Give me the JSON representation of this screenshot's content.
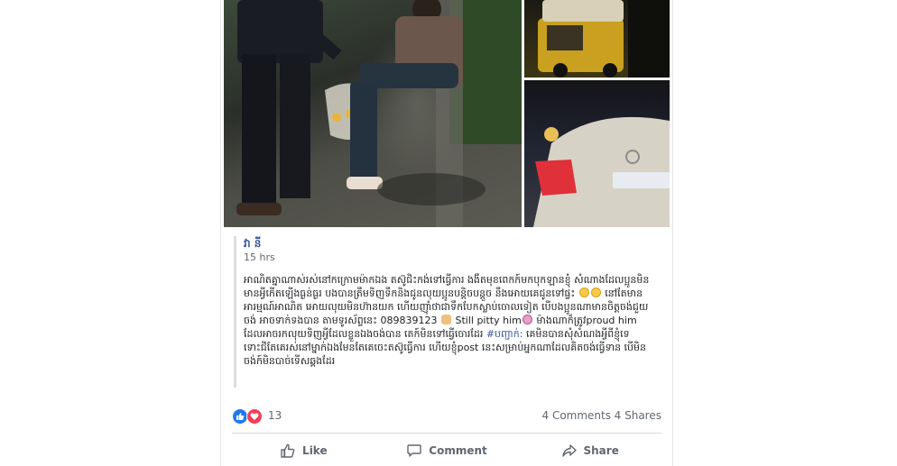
{
  "post": {
    "author": "វា នី",
    "time": "15 hrs",
    "body_lines": [
      "អាណិតគ្នាណាស់រស់នៅកក្រោមម៉ាកឯង តស៊ូជិះកង់ទៅធ្វើការ ងងឹតមុខពេកក៍មកបុកឡានខ្ញុំ",
      "សំណាងដែលប្អូនមិនមានអ្វីកើតឡើងធ្ងន់ធ្ងរ បងបានត្រឹមទិញទឹកនិងជូនលុយប្អូនបន្តិចបន្តួច",
      "នឹងអោយគេជូនទៅផ្ទះ",
      "នៅតែមានអារម្មណ៍អាណិត អោយលុយមិនហ៊ានយក",
      "ហើយញុាំថាជាទឹកបែកស្លាប់ចោលទៀត បើបងប្អូនណាមានចិត្តចង់ជួយចង់ អាចទាក់ទងបាន",
      "តាមទូរស័ព្ទនេះ 089839123",
      "Still pitty him",
      "ម៉ាងណាក៏ត្រូវproud him ដែលអាចរកលុយទិញអ្វីដែលខ្លួនឯងចង់បាន តេក៍មិនទៅធ្វើចោរដែរ",
      "#បញ្ជាក់:",
      "គេមិនបានសុំសំណងអ្វីពីខ្ញុំទេ ទោះជីតែគេរស់នៅម្នាក់ឯងមែនតែគេចេះតស៊ូធ្វើការ",
      "ហើយខ្ញុំpost នេះសម្រាប់អ្នកណាដែលគិតចង់ធ្វើទាន បើមិនចង់ក៍មិនបាច់ទើសឆ្គងដែរ"
    ]
  },
  "reactions": {
    "count": "13",
    "comments": "4 Comments",
    "shares": "4 Shares"
  },
  "actions": {
    "like": "Like",
    "comment": "Comment",
    "share": "Share"
  },
  "colors": {
    "link": "#385898",
    "like_blue": "#2078f4",
    "love_red": "#f33e58",
    "muted": "#606770"
  }
}
